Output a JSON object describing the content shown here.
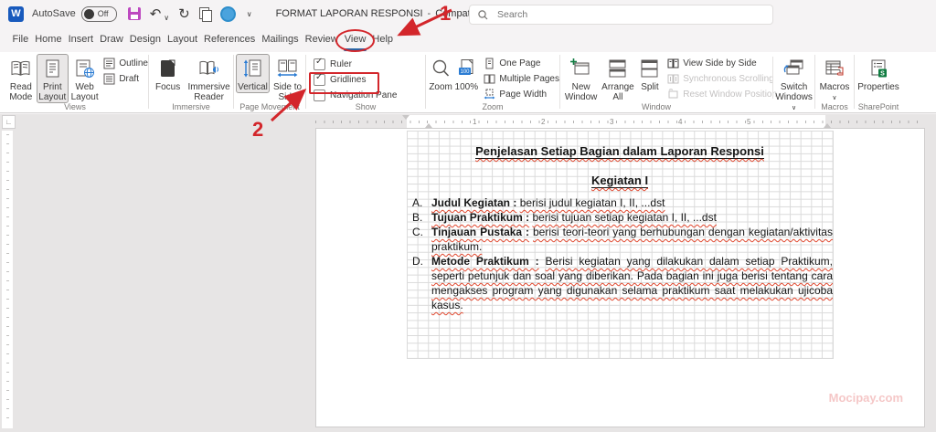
{
  "titlebar": {
    "app_initial": "W",
    "autosave_label": "AutoSave",
    "autosave_state": "Off",
    "document_title": "FORMAT LAPORAN RESPONSI",
    "separator": "-",
    "mode": "Compatibility Mode",
    "search_placeholder": "Search"
  },
  "tabs": [
    "File",
    "Home",
    "Insert",
    "Draw",
    "Design",
    "Layout",
    "References",
    "Mailings",
    "Review",
    "View",
    "Help"
  ],
  "active_tab": "View",
  "ribbon": {
    "views": {
      "label": "Views",
      "read_mode": "Read Mode",
      "print_layout": "Print Layout",
      "web_layout": "Web Layout",
      "outline": "Outline",
      "draft": "Draft",
      "selected": "Print Layout"
    },
    "immersive": {
      "label": "Immersive",
      "focus": "Focus",
      "immersive_reader": "Immersive Reader"
    },
    "page_movement": {
      "label": "Page Movement",
      "vertical": "Vertical",
      "side_to_side": "Side to Side",
      "selected": "Vertical"
    },
    "show": {
      "label": "Show",
      "ruler": "Ruler",
      "gridlines": "Gridlines",
      "navigation_pane": "Navigation Pane",
      "ruler_checked": true,
      "gridlines_checked": true,
      "navigation_pane_checked": false
    },
    "zoom": {
      "label": "Zoom",
      "zoom": "Zoom",
      "hundred": "100%",
      "badge": "100",
      "one_page": "One Page",
      "multiple_pages": "Multiple Pages",
      "page_width": "Page Width"
    },
    "window": {
      "label": "Window",
      "new_window": "New Window",
      "arrange_all": "Arrange All",
      "split": "Split",
      "view_side_by_side": "View Side by Side",
      "synchronous_scrolling": "Synchronous Scrolling",
      "reset_window_position": "Reset Window Position",
      "switch_windows": "Switch Windows"
    },
    "macros": {
      "label": "Macros",
      "macros": "Macros"
    },
    "sharepoint": {
      "label": "SharePoint",
      "properties": "Properties"
    }
  },
  "ruler": {
    "numbers": [
      "1",
      "2",
      "3",
      "4",
      "5"
    ]
  },
  "document": {
    "title": "Penjelasan Setiap Bagian dalam Laporan Responsi",
    "subtitle": "Kegiatan I",
    "items": [
      {
        "letter": "A.",
        "head": "Judul Kegiatan :",
        "body": "berisi judul kegiatan I, II, ...dst"
      },
      {
        "letter": "B.",
        "head": "Tujuan Praktikum :",
        "body": "berisi tujuan setiap kegiatan I, II, ...dst"
      },
      {
        "letter": "C.",
        "head": "Tinjauan Pustaka :",
        "body": "berisi teori-teori yang berhubungan dengan kegiatan/aktivitas praktikum."
      },
      {
        "letter": "D.",
        "head": "Metode Praktikum :",
        "body": "Berisi kegiatan yang dilakukan dalam setiap Praktikum, seperti petunjuk dan soal yang diberikan. Pada bagian ini juga berisi tentang cara mengakses program yang digunakan selama praktikum saat melakukan ujicoba kasus."
      }
    ],
    "watermark": "Mocipay.com"
  },
  "annotations": {
    "step1": "1",
    "step2": "2"
  },
  "icons": {
    "check": "✓",
    "dropdown": "∨",
    "undo": "↶",
    "redo": "↻",
    "tab_selector": "∟"
  },
  "colors": {
    "annotation_red": "#d3262b",
    "active_tab_blue": "#2466a8",
    "accent_blue": "#2b7cd3",
    "save_magenta": "#bd49c0",
    "word_blue": "#185abd",
    "squiggle_red": "#e0472e",
    "watermark_pink": "#e98282",
    "grid_line": "#dadada"
  }
}
